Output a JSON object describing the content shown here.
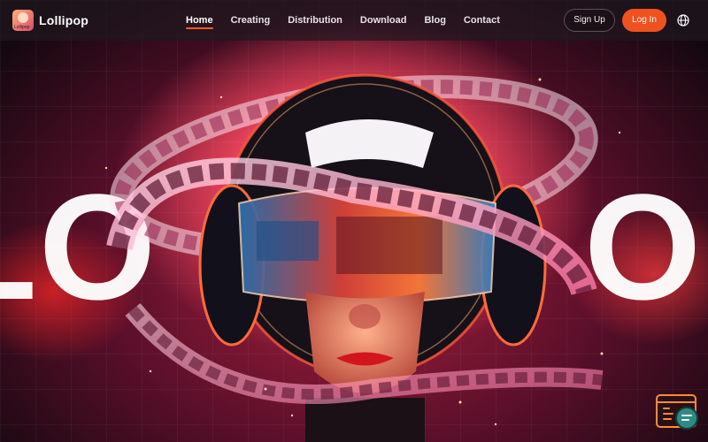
{
  "brand": {
    "name": "Lollipop",
    "logo_text": "Lollipop"
  },
  "nav": {
    "items": [
      {
        "label": "Home",
        "active": true
      },
      {
        "label": "Creating",
        "active": false
      },
      {
        "label": "Distribution",
        "active": false
      },
      {
        "label": "Download",
        "active": false
      },
      {
        "label": "Blog",
        "active": false
      },
      {
        "label": "Contact",
        "active": false
      }
    ]
  },
  "auth": {
    "signup_label": "Sign Up",
    "login_label": "Log In"
  },
  "icons": {
    "language": "globe-icon",
    "floating_widget": "code-chat-icon"
  },
  "hero": {
    "word_left": "LO",
    "word_right": "OL"
  },
  "colors": {
    "accent": "#f0521f",
    "nav_bg": "#20181e",
    "hero_glow": "#ff8a4a"
  }
}
